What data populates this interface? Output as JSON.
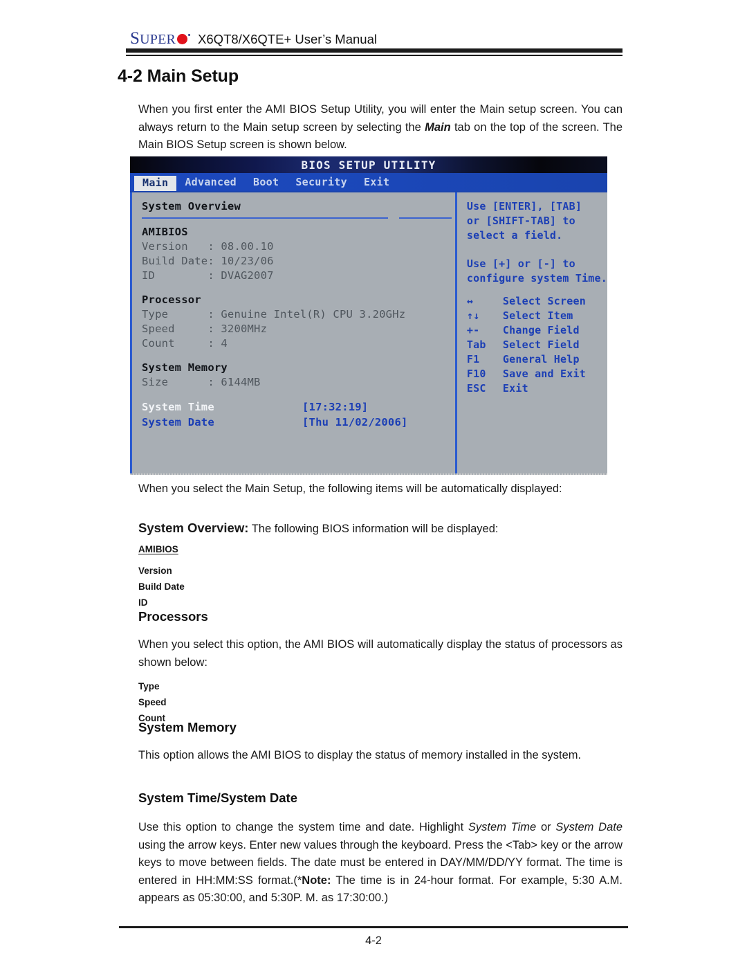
{
  "header": {
    "logo_super": "SUPER",
    "logo_s": "S",
    "logo_uper": "UPER",
    "title": "X6QT8/X6QTE+ User’s Manual"
  },
  "section": {
    "heading": "4-2 Main Setup"
  },
  "intro": {
    "paragraph": "When you first enter the AMI BIOS Setup Utility, you will enter the Main setup screen. You can always return to the Main setup screen by selecting the Main tab on the top of the screen. The Main BIOS Setup screen is shown below.",
    "p_part1": "When you first enter the AMI BIOS Setup Utility, you will enter the Main setup screen. You can always return to the Main setup screen by selecting the ",
    "p_bold": "Main",
    "p_part2": " tab on the top of the screen. The Main BIOS Setup screen is shown below."
  },
  "bios": {
    "title": "BIOS SETUP UTILITY",
    "menu": [
      {
        "label": "Main",
        "active": true
      },
      {
        "label": "Advanced",
        "active": false
      },
      {
        "label": "Boot",
        "active": false
      },
      {
        "label": "Security",
        "active": false
      },
      {
        "label": "Exit",
        "active": false
      }
    ],
    "overview_heading": "System Overview",
    "amibios": {
      "heading": "AMIBIOS",
      "rows": [
        {
          "label": "Version",
          "sep": ":",
          "value": "08.00.10"
        },
        {
          "label": "Build Date",
          "sep": ":",
          "value": "10/23/06"
        },
        {
          "label": "ID",
          "sep": ":",
          "value": "DVAG2007"
        }
      ],
      "line1": "Version   : 08.00.10",
      "line2": "Build Date: 10/23/06",
      "line3": "ID        : DVAG2007"
    },
    "processor": {
      "heading": "Processor",
      "line1": "Type      : Genuine Intel(R) CPU 3.20GHz",
      "line2": "Speed     : 3200MHz",
      "line3": "Count     : 4"
    },
    "memory": {
      "heading": "System Memory",
      "line1": "Size      : 6144MB"
    },
    "system_time": {
      "label": "System Time",
      "value": "[17:32:19]"
    },
    "system_date": {
      "label": "System Date",
      "value": "[Thu 11/02/2006]"
    },
    "help": {
      "block1": "Use [ENTER], [TAB]\nor [SHIFT-TAB] to\nselect a field.",
      "block2": "Use [+] or [-] to\nconfigure system Time.",
      "keys": [
        {
          "key": "↔",
          "action": "Select Screen"
        },
        {
          "key": "↑↓",
          "action": "Select Item"
        },
        {
          "key": "+-",
          "action": "Change Field"
        },
        {
          "key": "Tab",
          "action": "Select Field"
        },
        {
          "key": "F1",
          "action": "General Help"
        },
        {
          "key": "F10",
          "action": "Save and Exit"
        },
        {
          "key": "ESC",
          "action": "Exit"
        }
      ]
    },
    "colors": {
      "panel_bg": "#a8aeb4",
      "menu_bg": "#1c49bd",
      "help_blue": "#1c3fb5",
      "divider": "#3b63cf"
    }
  },
  "content": {
    "after_image": "When you select the  Main Setup, the following items will be automatically displayed:",
    "overview_bold": "System Overview:",
    "overview_rest": " The following BIOS information will be displayed:",
    "amibios_label": "AMIBIOS",
    "amibios_items": [
      "Version",
      "Build Date",
      "ID"
    ],
    "processors_heading": "Processors",
    "processors_para": "When you select this option, the AMI BIOS will automatically display the status of processors as shown below:",
    "processors_items": [
      "Type",
      "Speed",
      "Count"
    ],
    "memory_heading": "System Memory",
    "memory_para": "This option allows the AMI BIOS to display the status of memory installed in the system.",
    "time_heading": "System Time/System Date",
    "time_p1": "Use this option to change the system time and date. Highlight ",
    "time_i1": "System Time",
    "time_p2": " or ",
    "time_i2": "System Date",
    "time_p3": " using the arrow keys. Enter new values through the keyboard. Press the <Tab> key or the arrow keys to move between fields. The date must be entered in DAY/MM/DD/YY format. The time is entered in HH:MM:SS format.(*",
    "time_b1": "Note:",
    "time_p4": " The time is in 24-hour format. For example, 5:30 A.M. appears as 05:30:00, and 5:30P. M. as 17:30:00.)"
  },
  "footer": {
    "page_number": "4-2"
  }
}
